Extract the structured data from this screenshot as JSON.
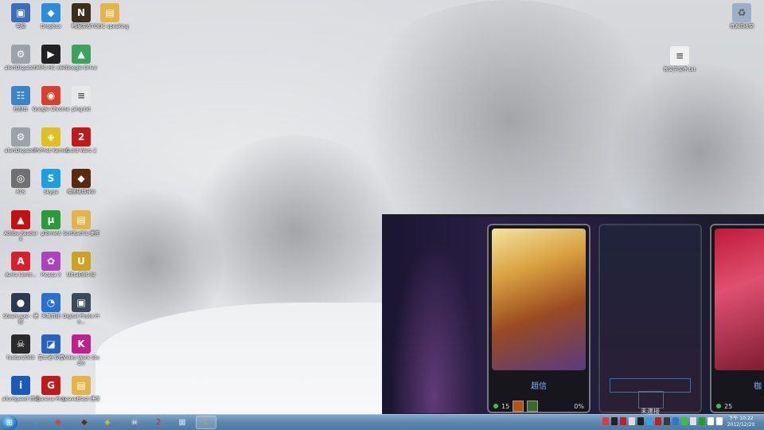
{
  "desktop_icons": [
    {
      "label": "电脑",
      "glyph": "▣",
      "color": "#3d6fb8",
      "icon": "computer-icon"
    },
    {
      "label": "Dropbox",
      "glyph": "◆",
      "color": "#2a8de0",
      "icon": "dropbox-icon"
    },
    {
      "label": "韩服游戏",
      "glyph": "N",
      "color": "#3a2f1a",
      "icon": "game-icon"
    },
    {
      "label": "TOEIC speaking",
      "glyph": "▤",
      "color": "#e2b44a",
      "icon": "folder-icon"
    },
    {
      "label": "alertDispatch",
      "glyph": "⚙",
      "color": "#9aa2aa",
      "icon": "shortcut-icon"
    },
    {
      "label": "MPC-HC x64",
      "glyph": "▶",
      "color": "#222",
      "icon": "media-player-icon"
    },
    {
      "label": "Google Drive",
      "glyph": "▲",
      "color": "#3aa55a",
      "icon": "google-drive-icon"
    },
    {
      "label": "控制台",
      "glyph": "☷",
      "color": "#3a84c8",
      "icon": "control-panel-icon"
    },
    {
      "label": "Google Chrome",
      "glyph": "◉",
      "color": "#d9402b",
      "icon": "chrome-icon"
    },
    {
      "label": "ping.txt",
      "glyph": "≡",
      "color": "#e8e8e8",
      "icon": "text-file-icon"
    },
    {
      "label": "alertDispatch",
      "glyph": "⚙",
      "color": "#9aa2aa",
      "icon": "shortcut-icon"
    },
    {
      "label": "PVPnet Kernel",
      "glyph": "◈",
      "color": "#e0c020",
      "icon": "pvpnet-icon"
    },
    {
      "label": "Guild Wars 2",
      "glyph": "2",
      "color": "#c01a1a",
      "icon": "guild-wars-icon"
    },
    {
      "label": "RTS",
      "glyph": "◎",
      "color": "#707070",
      "icon": "disk-icon"
    },
    {
      "label": "Skype",
      "glyph": "S",
      "color": "#1aa0e0",
      "icon": "skype-icon"
    },
    {
      "label": "暗黑破壞神III",
      "glyph": "◆",
      "color": "#5a2a10",
      "icon": "diablo-icon"
    },
    {
      "label": "Adobe Reader X",
      "glyph": "▲",
      "color": "#c41010",
      "icon": "adobe-reader-icon"
    },
    {
      "label": "µTorrent",
      "glyph": "µ",
      "color": "#2a9a3a",
      "icon": "utorrent-icon"
    },
    {
      "label": "Sortitachis 捷徑",
      "glyph": "▤",
      "color": "#e2b44a",
      "icon": "folder-shortcut-icon"
    },
    {
      "label": "Avira Contr...",
      "glyph": "A",
      "color": "#d8202a",
      "icon": "avira-icon"
    },
    {
      "label": "Picasa 3",
      "glyph": "✿",
      "color": "#b040c0",
      "icon": "picasa-icon"
    },
    {
      "label": "UltraEdit-32",
      "glyph": "U",
      "color": "#d0a020",
      "icon": "ultraedit-icon"
    },
    {
      "label": "Steam.exe - 捷徑",
      "glyph": "●",
      "color": "#2a3a50",
      "icon": "steam-icon"
    },
    {
      "label": "天氣資訊",
      "glyph": "◔",
      "color": "#2a70d0",
      "icon": "weather-icon"
    },
    {
      "label": "Digital Photo Pro...",
      "glyph": "▣",
      "color": "#3a4a5a",
      "icon": "photo-pro-icon"
    },
    {
      "label": "foobar2000",
      "glyph": "☠",
      "color": "#2a2a2a",
      "icon": "foobar-icon"
    },
    {
      "label": "富士通 軟體",
      "glyph": "◪",
      "color": "#2a60c0",
      "icon": "software-icon"
    },
    {
      "label": "Video Work Studio",
      "glyph": "K",
      "color": "#c0208a",
      "icon": "video-studio-icon"
    },
    {
      "label": "aTunSpeed 資訊",
      "glyph": "i",
      "color": "#1a5ab8",
      "icon": "info-icon"
    },
    {
      "label": "Garena Plus",
      "glyph": "G",
      "color": "#c01a1a",
      "icon": "garena-icon"
    },
    {
      "label": "LeaveBlast 捷徑",
      "glyph": "▤",
      "color": "#e2b44a",
      "icon": "folder-shortcut-icon"
    }
  ],
  "right_icons": [
    {
      "label": "資源回收筒",
      "glyph": "♻",
      "color": "#9ab0c8",
      "icon": "recycle-bin-icon"
    },
    {
      "label": "新文字文件.txt",
      "glyph": "≡",
      "color": "#f0f0f0",
      "icon": "text-file-icon"
    }
  ],
  "game": {
    "left_card": {
      "name": "趙信",
      "level": "15",
      "percent": "0%"
    },
    "middle_card": {
      "status": "未連接"
    },
    "right_card": {
      "name": "枷",
      "level": "25"
    }
  },
  "taskbar": {
    "items": [
      {
        "icon": "internet-explorer-icon",
        "glyph": "e",
        "color": "#3a9ae0"
      },
      {
        "icon": "chrome-icon",
        "glyph": "◉",
        "color": "#d9402b"
      },
      {
        "icon": "diablo-icon",
        "glyph": "◆",
        "color": "#6a2a10"
      },
      {
        "icon": "pvpnet-icon",
        "glyph": "◈",
        "color": "#e0c020"
      },
      {
        "icon": "foobar-icon",
        "glyph": "☠",
        "color": "#ffffff"
      },
      {
        "icon": "guild-wars-icon",
        "glyph": "2",
        "color": "#e02020"
      },
      {
        "icon": "network-icon",
        "glyph": "▦",
        "color": "#bfe0ff"
      },
      {
        "icon": "league-icon",
        "glyph": "L",
        "color": "#c8a850"
      }
    ],
    "time": "下午 10:22",
    "date": "2012/12/20",
    "start_glyph": "⊞"
  }
}
